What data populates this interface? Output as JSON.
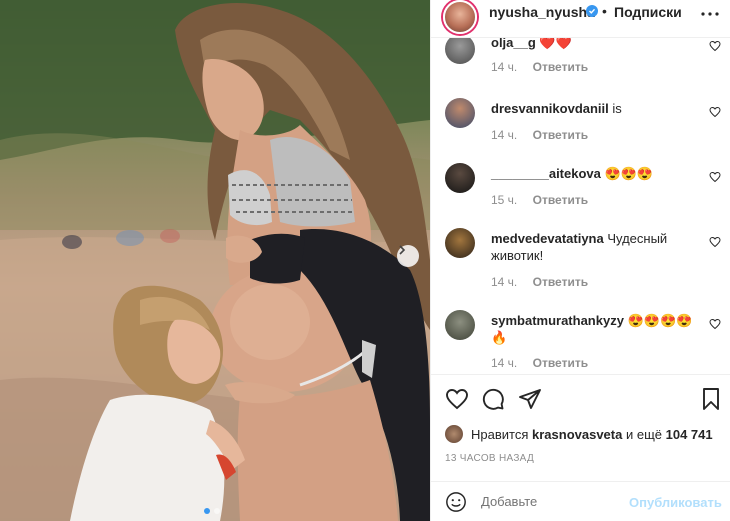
{
  "post": {
    "header": {
      "username": "nyusha_nyusha",
      "separator": "•",
      "follow_label": "Подписки",
      "more_icon": "more-horizontal-icon"
    },
    "comments": [
      {
        "username": "olja__g",
        "text": "",
        "emoji": "❤️❤️",
        "time": "14 ч.",
        "reply": "Ответить"
      },
      {
        "username": "dresvannikovdaniil",
        "text": "is",
        "emoji": "",
        "time": "14 ч.",
        "reply": "Ответить"
      },
      {
        "username": "________aitekova",
        "text": "",
        "emoji": "😍😍😍",
        "time": "15 ч.",
        "reply": "Ответить"
      },
      {
        "username": "medvedevatatiyna",
        "text": "Чудесный животик!",
        "emoji": "",
        "time": "14 ч.",
        "reply": "Ответить"
      },
      {
        "username": "symbatmurathankyzy",
        "text": "",
        "emoji": "😍😍😍😍🔥",
        "time": "14 ч.",
        "reply": "Ответить"
      }
    ],
    "likes": {
      "prefix": "Нравится",
      "user": "krasnovasveta",
      "middle": "и ещё",
      "count": "104 741"
    },
    "timestamp": "13 ЧАСОВ НАЗАД",
    "add_comment": {
      "placeholder": "Добавьте",
      "post_label": "Опубликовать"
    },
    "colors": {
      "link_blue": "#3897f0",
      "like_red": "#ed4956",
      "muted": "#8e8e8e"
    }
  }
}
